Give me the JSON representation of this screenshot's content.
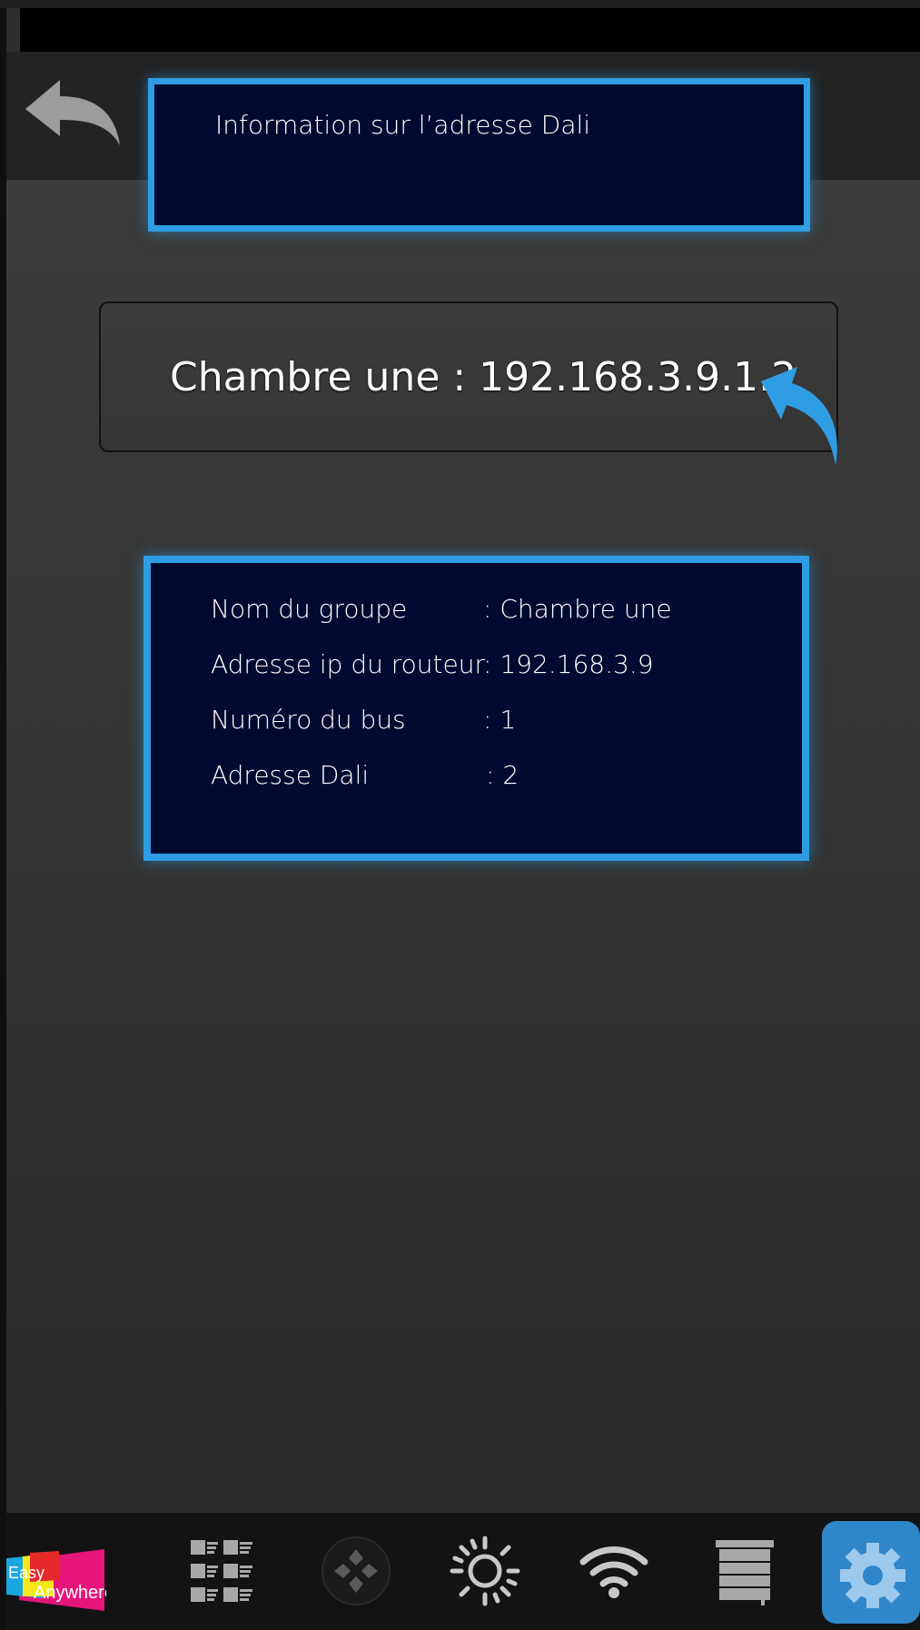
{
  "header": {
    "title": "Information sur l’adresse Dali"
  },
  "address": {
    "text": "Chambre une : 192.168.3.9.1.2"
  },
  "info": {
    "rows": [
      {
        "label": "Nom du groupe",
        "value": ":  Chambre une"
      },
      {
        "label": "Adresse ip du routeur",
        "value": ": 192.168.3.9"
      },
      {
        "label": "Numéro du bus",
        "value": ": 1"
      },
      {
        "label": "Adresse Dali",
        "value": ": 2"
      }
    ]
  },
  "logo": {
    "text_easy": "Easy",
    "text_anywhere": "Anywhere"
  },
  "tabs": [
    {
      "icon": "grid-list-icon"
    },
    {
      "icon": "dpad-icon"
    },
    {
      "icon": "sun-icon"
    },
    {
      "icon": "wifi-icon"
    },
    {
      "icon": "blinds-icon"
    },
    {
      "icon": "gear-icon",
      "active": true
    }
  ],
  "colors": {
    "accent": "#2f9de4",
    "panel": "#000a30",
    "active_tab": "#2f86c9"
  }
}
